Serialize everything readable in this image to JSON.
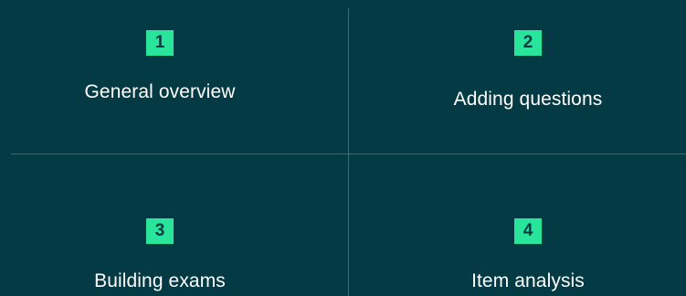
{
  "colors": {
    "background": "#033a44",
    "badge": "#28e59b",
    "badge_text": "#033a44",
    "label_text": "#ffffff",
    "divider": "#3f6a72"
  },
  "grid": {
    "items": [
      {
        "number": "1",
        "label": "General overview"
      },
      {
        "number": "2",
        "label": "Adding questions"
      },
      {
        "number": "3",
        "label": "Building exams"
      },
      {
        "number": "4",
        "label": "Item analysis"
      }
    ]
  }
}
